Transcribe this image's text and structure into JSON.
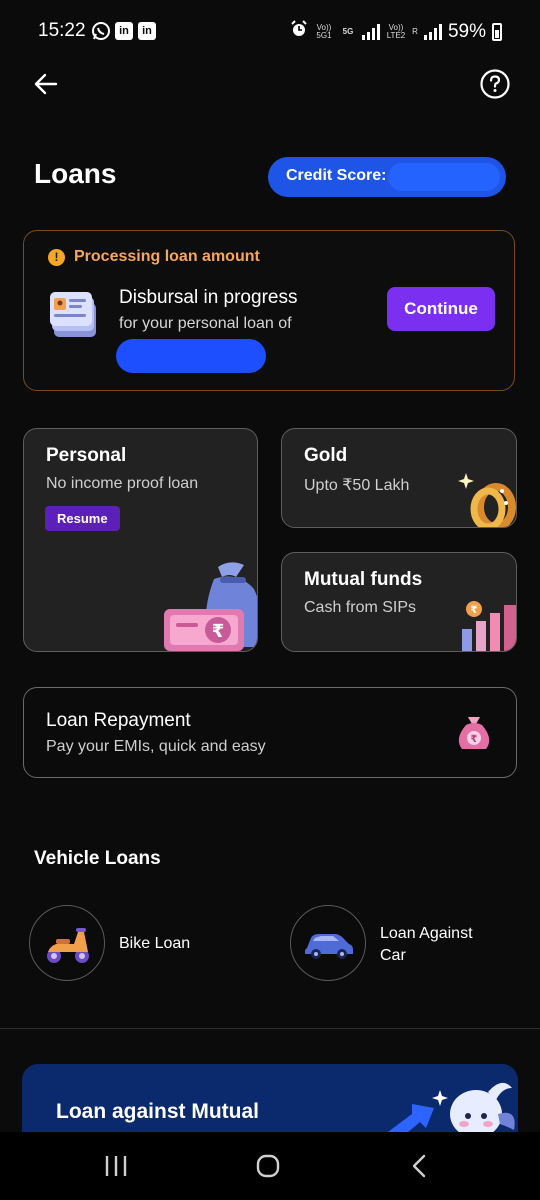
{
  "status_bar": {
    "time": "15:22",
    "battery": "59%",
    "net_labels": [
      "Vo)) 5G1",
      "5G",
      "Vo)) LTE2",
      "R"
    ]
  },
  "header": {
    "title": "Loans",
    "credit_score_label": "Credit Score:"
  },
  "processing": {
    "status": "Processing loan amount",
    "heading": "Disbursal in progress",
    "subtext": "for your personal loan of",
    "button": "Continue"
  },
  "loan_types": {
    "personal": {
      "title": "Personal",
      "subtitle": "No income proof loan",
      "badge": "Resume"
    },
    "gold": {
      "title": "Gold",
      "subtitle": "Upto ₹50 Lakh"
    },
    "mutual_funds": {
      "title": "Mutual funds",
      "subtitle": "Cash from SIPs"
    }
  },
  "repayment": {
    "title": "Loan Repayment",
    "subtitle": "Pay your EMIs, quick and easy"
  },
  "vehicle": {
    "section_title": "Vehicle Loans",
    "bike": "Bike Loan",
    "car_line1": "Loan Against",
    "car_line2": "Car"
  },
  "promo": {
    "title": "Loan against Mutual"
  },
  "colors": {
    "accent_purple": "#7b2ff0",
    "credit_blue": "#1f55e6",
    "warning_orange": "#f5a65a",
    "background": "#0b0b0b"
  }
}
